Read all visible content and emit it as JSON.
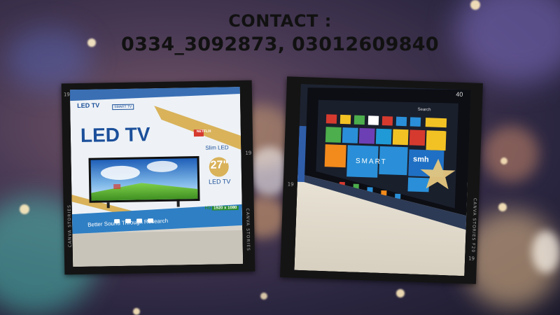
{
  "contact": {
    "line1": "CONTACT :",
    "line2": "0334_3092873, 03012609840"
  },
  "left_photo": {
    "box_heading": "LED TV",
    "badge_smart": "SMART TV",
    "slim_label": "Slim LED",
    "size_label": "27\"",
    "led_tv_label": "LED TV",
    "netflix_label": "NETFLIX",
    "hd_label": "HD",
    "hd_resolution": "1920 x 1080",
    "tagline": "Better Sound Through Research",
    "film_label": "CANVA STORIES",
    "film_number": "19"
  },
  "right_photo": {
    "search_label": "Search",
    "smart_label": "SMART",
    "smh_label": "smh",
    "corner_number": "40",
    "film_label": "CANVA STORIES F20",
    "film_number": "19"
  },
  "colors": {
    "box_blue": "#2f7fc4",
    "box_white": "#eef2f6",
    "gold": "#d9b25a",
    "tile_red": "#d63a2f",
    "tile_blue": "#2a8fd8",
    "tile_yellow": "#f2c224",
    "tile_green": "#4cae4c"
  }
}
